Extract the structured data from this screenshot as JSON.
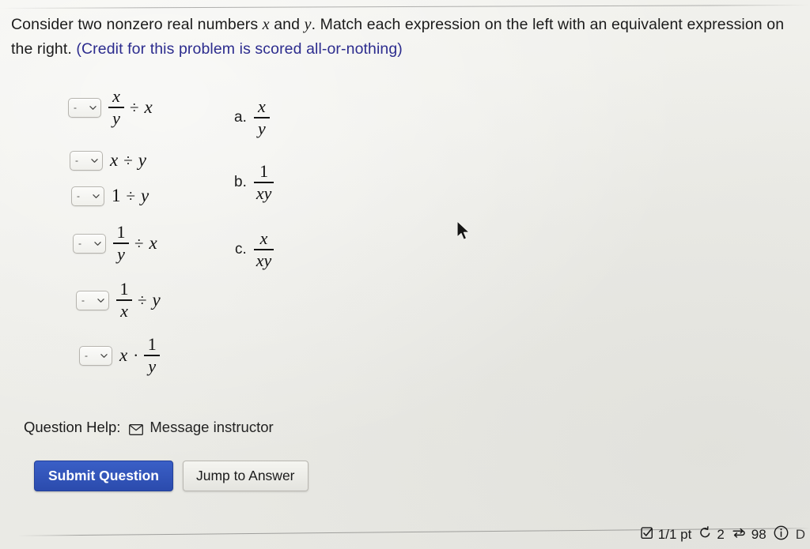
{
  "prompt": {
    "part1": "Consider two nonzero real numbers ",
    "var_x": "x",
    "mid1": " and ",
    "var_y": "y",
    "part2": ". Match each expression on the left with an equivalent expression on the right. ",
    "credit_note": "(Credit for this problem is scored all-or-nothing)"
  },
  "select": {
    "value": "-",
    "icon": "chevron-down-icon"
  },
  "left_items": [
    {
      "id": 1,
      "expression": "x/y ÷ x",
      "numerator": "x",
      "denominator": "y",
      "operator": "÷",
      "operand": "x",
      "form": "frac-op-term"
    },
    {
      "id": 2,
      "expression": "x ÷ y",
      "lhs": "x",
      "operator": "÷",
      "operand": "y",
      "form": "term-op-term"
    },
    {
      "id": 3,
      "expression": "1 ÷ y",
      "lhs": "1",
      "operator": "÷",
      "operand": "y",
      "form": "term-op-term"
    },
    {
      "id": 4,
      "expression": "1/y ÷ x",
      "numerator": "1",
      "denominator": "y",
      "operator": "÷",
      "operand": "x",
      "form": "frac-op-term"
    },
    {
      "id": 5,
      "expression": "1/x ÷ y",
      "numerator": "1",
      "denominator": "x",
      "operator": "÷",
      "operand": "y",
      "form": "frac-op-term"
    },
    {
      "id": 6,
      "expression": "x · 1/y",
      "lhs": "x",
      "operator": "·",
      "numerator": "1",
      "denominator": "y",
      "form": "term-op-frac"
    }
  ],
  "right_options": [
    {
      "label": "a.",
      "expression": "x/(y)",
      "numerator": "x",
      "denominator": "y"
    },
    {
      "label": "b.",
      "expression": "1/(xy)",
      "numerator": "1",
      "denominator": "xy"
    },
    {
      "label": "c.",
      "expression": "x/(xy)",
      "numerator": "x",
      "denominator": "xy"
    }
  ],
  "help": {
    "label": "Question Help:",
    "message_instructor": "Message instructor",
    "icon": "envelope-icon"
  },
  "buttons": {
    "submit": "Submit Question",
    "jump": "Jump to Answer"
  },
  "status": {
    "points": "1/1 pt",
    "attempts": "2",
    "views": "98",
    "trailing": "D",
    "icons": {
      "points": "checked-square-icon",
      "attempts": "rotate-ccw-icon",
      "views": "swap-arrows-icon",
      "info": "info-circle-icon"
    }
  },
  "colors": {
    "background": "#eeeeea",
    "credit_text": "#2c2c8e",
    "submit_button": "#2b4bad",
    "text": "#1b1b1b"
  }
}
